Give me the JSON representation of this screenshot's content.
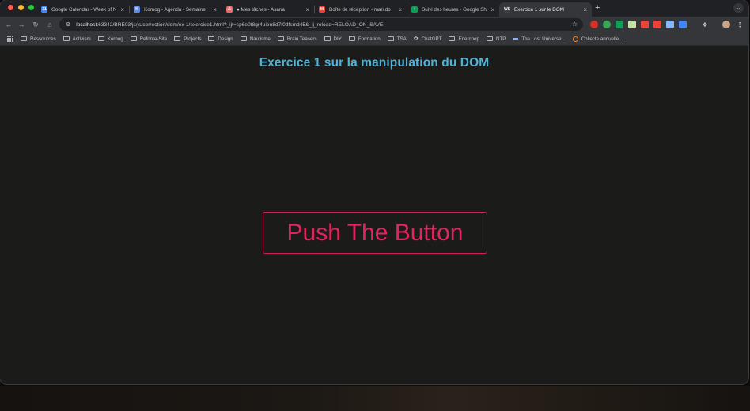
{
  "browser": {
    "tabs": [
      {
        "title": "Google Calendar - Week of N",
        "favicon_color": "#4285f4",
        "favicon_glyph": "31",
        "active": false
      },
      {
        "title": "Kornog - Agenda - Semaine",
        "favicon_color": "#5b8def",
        "favicon_glyph": "K",
        "active": false
      },
      {
        "title": "● Mes tâches - Asana",
        "favicon_color": "#f06a6a",
        "favicon_glyph": "⁂",
        "active": false
      },
      {
        "title": "Boîte de réception - mari.do",
        "favicon_color": "#ea4335",
        "favicon_glyph": "M",
        "active": false
      },
      {
        "title": "Suivi des heures - Google Sh",
        "favicon_color": "#0f9d58",
        "favicon_glyph": "+",
        "active": false
      },
      {
        "title": "Exercice 1 sur le DOM",
        "favicon_color": "#3c4043",
        "favicon_glyph": "WS",
        "active": true
      }
    ],
    "tab_close_glyph": "×",
    "new_tab_glyph": "+",
    "tab_menu_glyph": "⌄",
    "url_host": "localhost",
    "url_rest": ":63342/BRE03/js/js/correction/dom/ex-1/exercice1.html?_ijt=sp6e0t8gr4uien8d7f0dfsmd45&_ij_reload=RELOAD_ON_SAVE",
    "bookmarks": [
      "Ressources",
      "Activism",
      "Kornog",
      "Refonte-Site",
      "Projects",
      "Design",
      "Nautisme",
      "Brain Teasers",
      "DIY",
      "Formation",
      "TSA"
    ],
    "bookmark_chatgpt": "ChatGPT",
    "bookmarks_2": [
      "Enercoop",
      "NTP"
    ],
    "bookmark_lost": "The Lost Universe...",
    "bookmark_collecte": "Collecte annuelle...",
    "extension_colors": [
      "#d93025",
      "#34a853",
      "#0f9d58",
      "#c5e1a5",
      "#e8453c",
      "#ea4335",
      "#8ab4f8",
      "#4285f4"
    ]
  },
  "page": {
    "title": "Exercice 1 sur la manipulation du DOM",
    "button_label": "Push The Button",
    "title_color": "#4fb3d9",
    "button_color": "#e0245e",
    "background": "#1b1c1a"
  }
}
